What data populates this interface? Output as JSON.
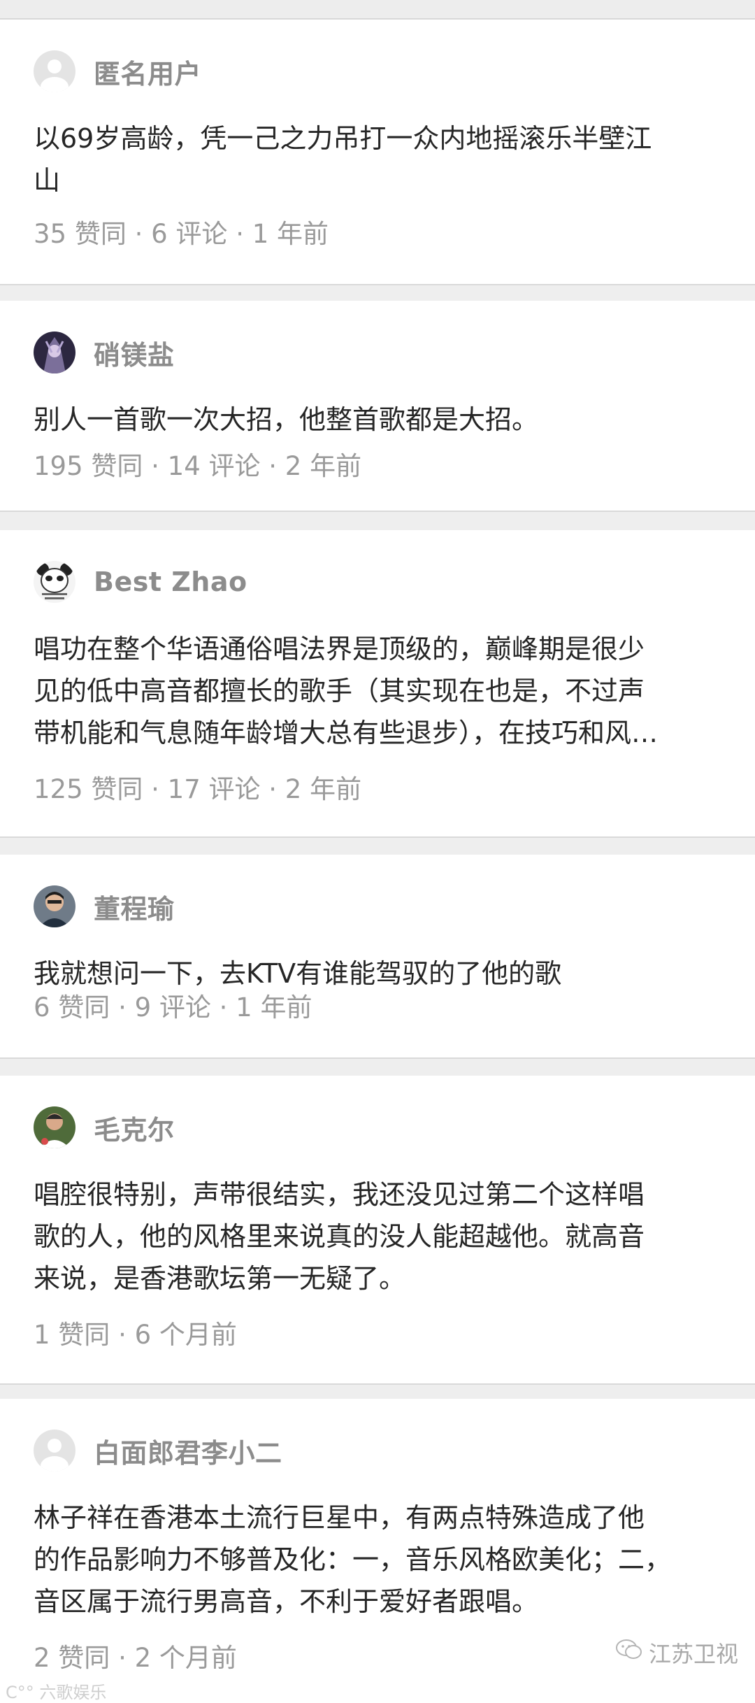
{
  "comments": [
    {
      "username": "匿名用户",
      "avatar_icon": "anonymous-user-icon",
      "lines": [
        "以69岁高龄，凭一己之力吊打一众内地摇滚乐半壁江",
        "山"
      ],
      "meta": "35 赞同 · 6 评论 · 1 年前"
    },
    {
      "username": "硝镁盐",
      "avatar_icon": "user-photo-avatar",
      "lines": [
        "别人一首歌一次大招，他整首歌都是大招。"
      ],
      "meta": "195 赞同 · 14 评论 · 2 年前"
    },
    {
      "username": "Best Zhao",
      "avatar_icon": "panda-meme-avatar",
      "lines": [
        "唱功在整个华语通俗唱法界是顶级的，巅峰期是很少",
        "见的低中高音都擅长的歌手（其实现在也是，不过声",
        "带机能和气息随年龄增大总有些退步），在技巧和风…"
      ],
      "meta": "125 赞同 · 17 评论 · 2 年前"
    },
    {
      "username": "董程瑜",
      "avatar_icon": "user-photo-avatar",
      "lines": [
        "我就想问一下，去KTV有谁能驾驭的了他的歌"
      ],
      "meta": "6 赞同 · 9 评论 · 1 年前"
    },
    {
      "username": "毛克尔",
      "avatar_icon": "user-photo-avatar",
      "lines": [
        "唱腔很特别，声带很结实，我还没见过第二个这样唱",
        "歌的人，他的风格里来说真的没人能超越他。就高音",
        "来说，是香港歌坛第一无疑了。"
      ],
      "meta": "1 赞同 · 6 个月前"
    },
    {
      "username": "白面郎君李小二",
      "avatar_icon": "anonymous-user-icon",
      "lines": [
        "林子祥在香港本土流行巨星中，有两点特殊造成了他",
        "的作品影响力不够普及化：一，音乐风格欧美化；二，",
        "音区属于流行男高音，不利于爱好者跟唱。"
      ],
      "meta": "2 赞同 · 2 个月前"
    }
  ],
  "watermarks": {
    "left": "六歌娱乐",
    "right": "江苏卫视"
  }
}
